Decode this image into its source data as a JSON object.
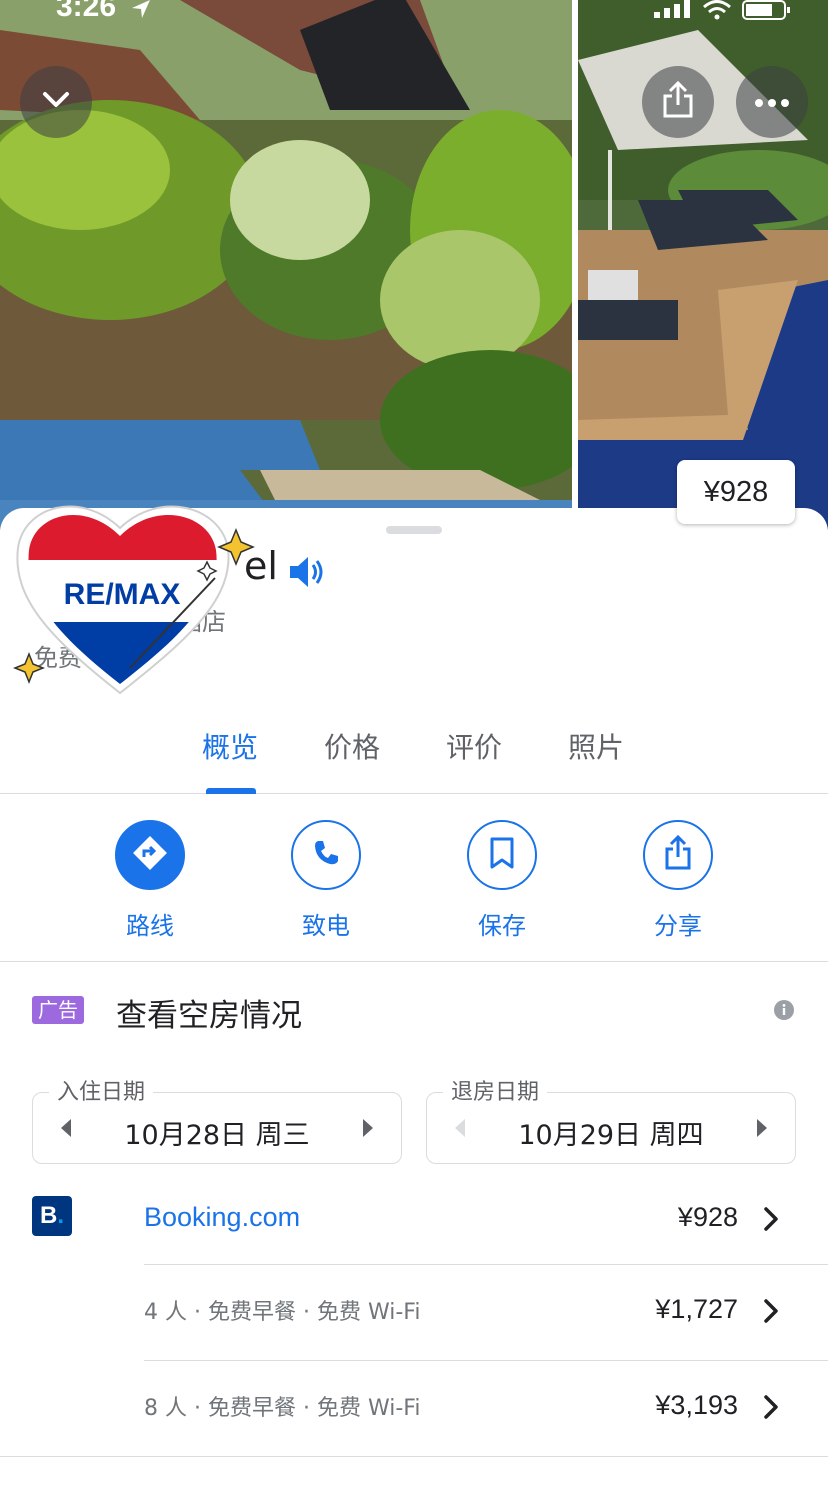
{
  "status_bar": {
    "time": "3:26"
  },
  "photos": {
    "price_chip": "¥928"
  },
  "place": {
    "title_partial": "el",
    "sub1_partial": "酒店",
    "sub2_partial": "免费"
  },
  "tabs": [
    {
      "label": "概览",
      "active": true
    },
    {
      "label": "价格",
      "active": false
    },
    {
      "label": "评价",
      "active": false
    },
    {
      "label": "照片",
      "active": false
    }
  ],
  "actions": [
    {
      "label": "路线",
      "icon": "directions-icon"
    },
    {
      "label": "致电",
      "icon": "phone-icon"
    },
    {
      "label": "保存",
      "icon": "bookmark-icon"
    },
    {
      "label": "分享",
      "icon": "share-icon"
    }
  ],
  "availability": {
    "ad_badge": "广告",
    "title": "查看空房情况",
    "checkin": {
      "label": "入住日期",
      "value": "10月28日 周三"
    },
    "checkout": {
      "label": "退房日期",
      "value": "10月29日 周四"
    }
  },
  "offers": {
    "provider": "Booking.com",
    "provider_logo": "B",
    "rows": [
      {
        "desc": "",
        "price": "¥928"
      },
      {
        "desc": "4 人 · 免费早餐 · 免费 Wi-Fi",
        "price": "¥1,727"
      },
      {
        "desc": "8 人 · 免费早餐 · 免费 Wi-Fi",
        "price": "¥3,193"
      }
    ]
  },
  "sticker": {
    "brand_text": "RE/MAX"
  },
  "colors": {
    "accent": "#1a73e8",
    "ad_badge": "#9c6ade",
    "booking_brand": "#003580"
  }
}
